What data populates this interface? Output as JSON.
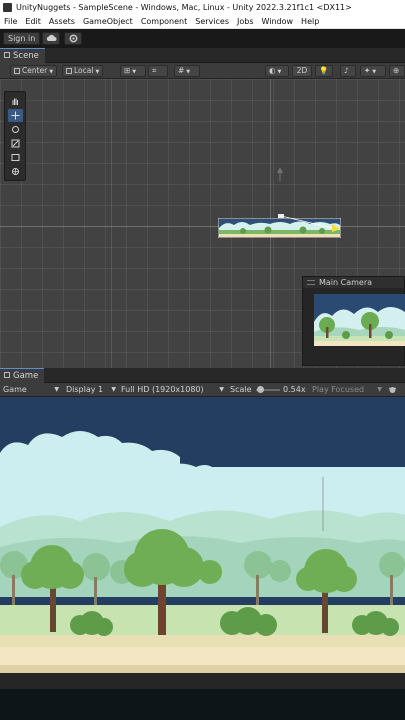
{
  "window": {
    "title": "UnityNuggets - SampleScene - Windows, Mac, Linux - Unity 2022.3.21f1c1 <DX11>"
  },
  "menu": {
    "items": [
      "File",
      "Edit",
      "Assets",
      "GameObject",
      "Component",
      "Services",
      "Jobs",
      "Window",
      "Help"
    ]
  },
  "toolbar": {
    "sign_in_label": "Sign in",
    "cloud_icon": "cloud-icon",
    "collab_icon": "gear-icon"
  },
  "scene": {
    "tab_label": "Scene",
    "pivot_label": "Center",
    "space_label": "Local",
    "mode_2d_label": "2D",
    "tools": [
      "hand-tool-icon",
      "move-tool-icon",
      "rotate-tool-icon",
      "scale-tool-icon",
      "rect-tool-icon",
      "transform-tool-icon"
    ],
    "active_tool_index": 1
  },
  "camera_preview": {
    "title": "Main Camera"
  },
  "game": {
    "tab_label": "Game",
    "view_mode": "Game",
    "display": "Display 1",
    "resolution": "Full HD (1920x1080)",
    "scale_label": "Scale",
    "scale_value": "0.54x",
    "play_mode": "Play Focused"
  },
  "colors": {
    "sky": "#243e61",
    "clouds": "#cdeef0",
    "hills": "#a9d8c0",
    "trees": "#6fae55",
    "ground": "#f3e6c2",
    "accent": "#3a5a85"
  }
}
